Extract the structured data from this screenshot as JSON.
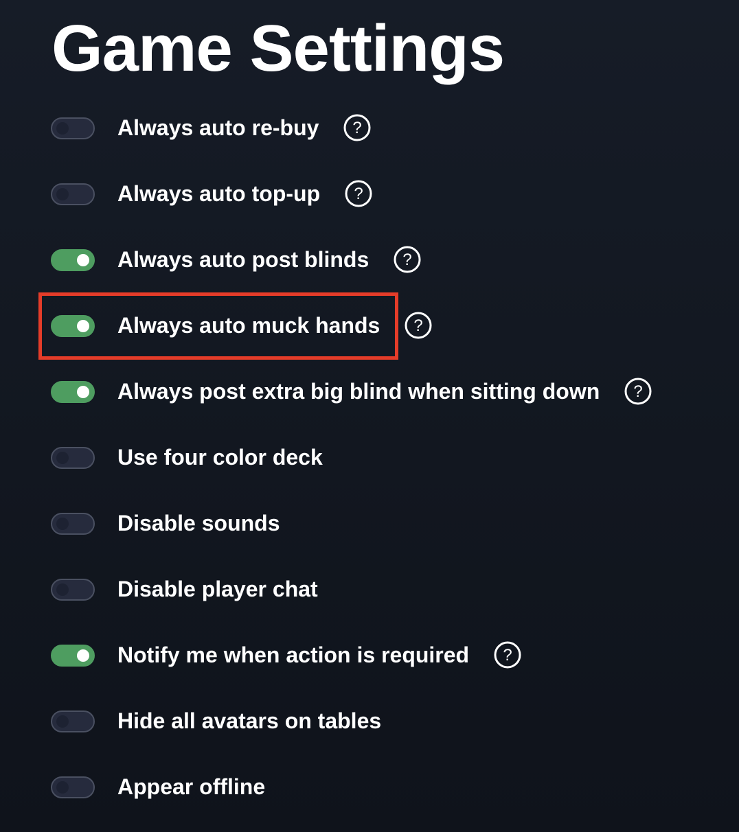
{
  "page": {
    "title": "Game Settings"
  },
  "settings": [
    {
      "label": "Always auto re-buy",
      "enabled": false,
      "has_help": true
    },
    {
      "label": "Always auto top-up",
      "enabled": false,
      "has_help": true
    },
    {
      "label": "Always auto post blinds",
      "enabled": true,
      "has_help": true
    },
    {
      "label": "Always auto muck hands",
      "enabled": true,
      "has_help": true,
      "highlighted": true
    },
    {
      "label": "Always post extra big blind when sitting down",
      "enabled": true,
      "has_help": true
    },
    {
      "label": "Use four color deck",
      "enabled": false,
      "has_help": false
    },
    {
      "label": "Disable sounds",
      "enabled": false,
      "has_help": false
    },
    {
      "label": "Disable player chat",
      "enabled": false,
      "has_help": false
    },
    {
      "label": "Notify me when action is required",
      "enabled": true,
      "has_help": true
    },
    {
      "label": "Hide all avatars on tables",
      "enabled": false,
      "has_help": false
    },
    {
      "label": "Appear offline",
      "enabled": false,
      "has_help": false
    }
  ],
  "icons": {
    "help": "question-circle-icon"
  },
  "colors": {
    "toggle_on": "#4e9d60",
    "toggle_off": "#262b3d",
    "highlight": "#e53c29",
    "background": "#131922"
  }
}
